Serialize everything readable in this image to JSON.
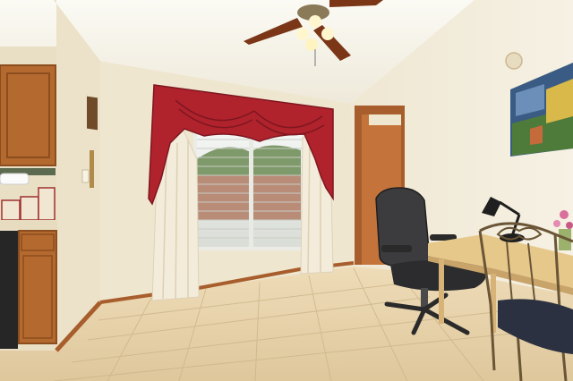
{
  "scene": {
    "kind": "room-photo",
    "colors": {
      "wall": "#f1ead6",
      "ceiling": "#f6f3e8",
      "floor_tile": "#e6d3ae",
      "valance": "#b0232c",
      "cabinet_wood": "#b4692f",
      "door_wood": "#c4743a"
    }
  }
}
